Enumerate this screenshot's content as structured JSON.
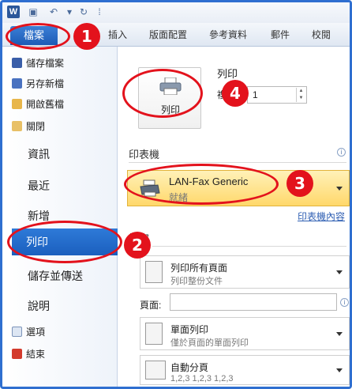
{
  "toolbar": {
    "word_logo": "W"
  },
  "tabs": {
    "file": "檔案",
    "items": [
      "插入",
      "版面配置",
      "參考資料",
      "郵件",
      "校閱"
    ]
  },
  "nav": {
    "small_items": [
      "儲存檔案",
      "另存新檔",
      "開啟舊檔",
      "關閉"
    ],
    "large_items": [
      "資訊",
      "最近",
      "新增",
      "列印",
      "儲存並傳送",
      "說明"
    ],
    "bottom_items": [
      "選項",
      "結束"
    ]
  },
  "print": {
    "title": "列印",
    "button_label": "列印",
    "copies_label": "複",
    "copies_value": "1"
  },
  "printer": {
    "section_title": "印表機",
    "name": "LAN-Fax Generic",
    "status": "就緒",
    "properties_link": "印表機內容"
  },
  "settings": {
    "section_title": "設定",
    "range_l1": "列印所有頁面",
    "range_l2": "列印整份文件",
    "pages_label": "頁面:",
    "sides_l1": "單面列印",
    "sides_l2": "僅於頁面的單面列印",
    "collate_l1": "自動分頁",
    "collate_l2": "1,2,3    1,2,3    1,2,3"
  },
  "badges": {
    "b1": "1",
    "b2": "2",
    "b3": "3",
    "b4": "4"
  },
  "colors": {
    "accent": "#1d5bb6",
    "highlight": "#ffd86b",
    "annotation": "#e3121c"
  }
}
